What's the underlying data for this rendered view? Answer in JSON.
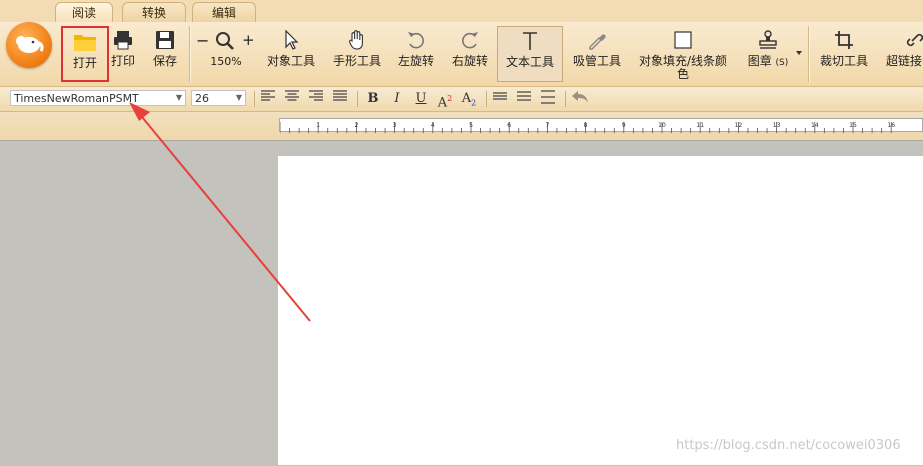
{
  "tabs": [
    {
      "label": "阅读",
      "active": true
    },
    {
      "label": "转换",
      "active": false
    },
    {
      "label": "编辑",
      "active": false
    }
  ],
  "toolbar": {
    "open": "打开",
    "print": "打印",
    "save": "保存",
    "zoom_level": "150%",
    "zoom_out_glyph": "−",
    "zoom_in_glyph": "+",
    "object_tool": "对象工具",
    "hand_tool": "手形工具",
    "rotate_left": "左旋转",
    "rotate_right": "右旋转",
    "text_tool": "文本工具",
    "eyedropper_tool": "吸管工具",
    "fill_line_color_1": "对象填充/线条颜",
    "fill_line_color_2": "色",
    "stamp": "图章",
    "stamp_shortcut": "(S)",
    "crop_tool": "裁切工具",
    "hyperlink": "超链接"
  },
  "format": {
    "font_family": "TimesNewRomanPSMT",
    "font_size": "26",
    "bold": "B",
    "italic": "I",
    "underline": "U",
    "superscript": "A",
    "superscript_mark": "2",
    "subscript": "A",
    "subscript_mark": "2"
  },
  "ruler": {
    "labels": [
      "1",
      "2",
      "3",
      "4",
      "5",
      "6",
      "7",
      "8",
      "9",
      "10",
      "11",
      "12",
      "13",
      "14",
      "15",
      "16"
    ]
  },
  "watermark": "https://blog.csdn.net/cocowei0306",
  "colors": {
    "accent_red": "#e03030",
    "toolbar_bg": "#f2d8a9",
    "logo_orange": "#f07a10"
  }
}
